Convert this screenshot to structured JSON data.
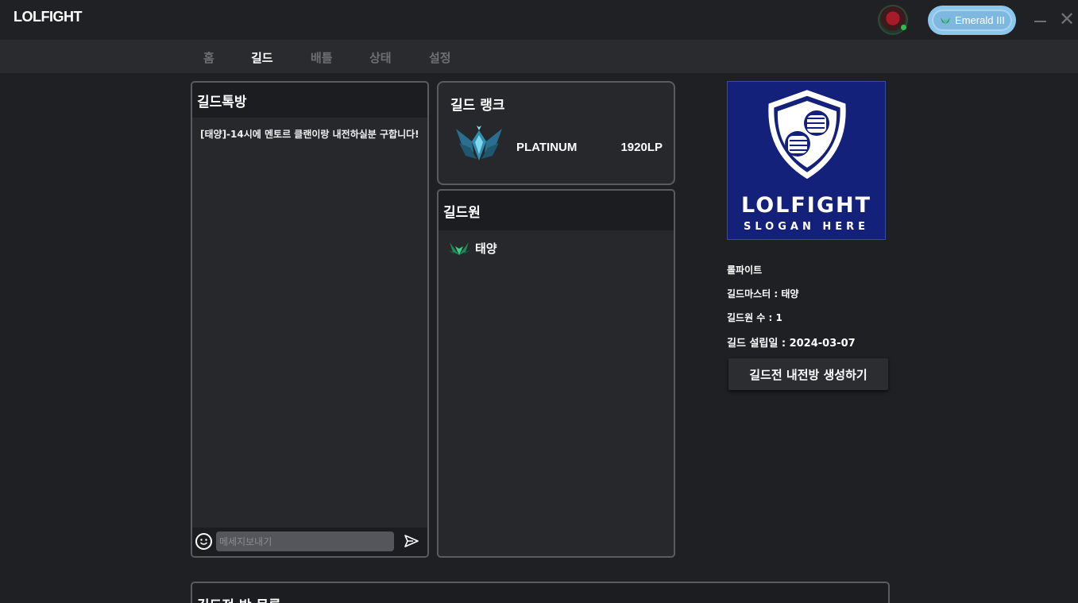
{
  "app": {
    "title": "LOLFIGHT"
  },
  "header": {
    "rank_badge_label": "Emerald III",
    "close_glyph": "✕"
  },
  "nav": {
    "items": [
      {
        "label": "홈"
      },
      {
        "label": "길드"
      },
      {
        "label": "배틀"
      },
      {
        "label": "상태"
      },
      {
        "label": "설정"
      }
    ],
    "active": "길드"
  },
  "chat": {
    "title": "길드톡방",
    "messages": [
      {
        "text": "[태양]-14시에 멘토르 클랜이랑 내전하실분 구합니다!"
      }
    ],
    "input_placeholder": "메세지보내기"
  },
  "guild_rank": {
    "title": "길드 랭크",
    "tier": "PLATINUM",
    "lp": "1920LP",
    "emblem_icon": "platinum-emblem-icon"
  },
  "members": {
    "title": "길드원",
    "list": [
      {
        "name": "태양",
        "tier_icon": "emerald-tier-icon"
      }
    ]
  },
  "guild_info": {
    "logo_name": "LOLFIGHT",
    "logo_slogan": "SLOGAN HERE",
    "name": "롤파이트",
    "master": "길드마스터 : 태양",
    "member_count": "길드원 수 : 1",
    "founded": "길드 설립일 : 2024-03-07",
    "create_button": "길드전 내전방 생성하기"
  },
  "room_list": {
    "title": "길드전 방 목록"
  },
  "colors": {
    "background": "#1f2024",
    "panel": "#27282c",
    "panel_header": "#1c1d20",
    "border": "#5a5b60",
    "rank_pill": "#8cc6ec",
    "logo_bg": "#14217a",
    "emerald": "#2fae6e"
  }
}
